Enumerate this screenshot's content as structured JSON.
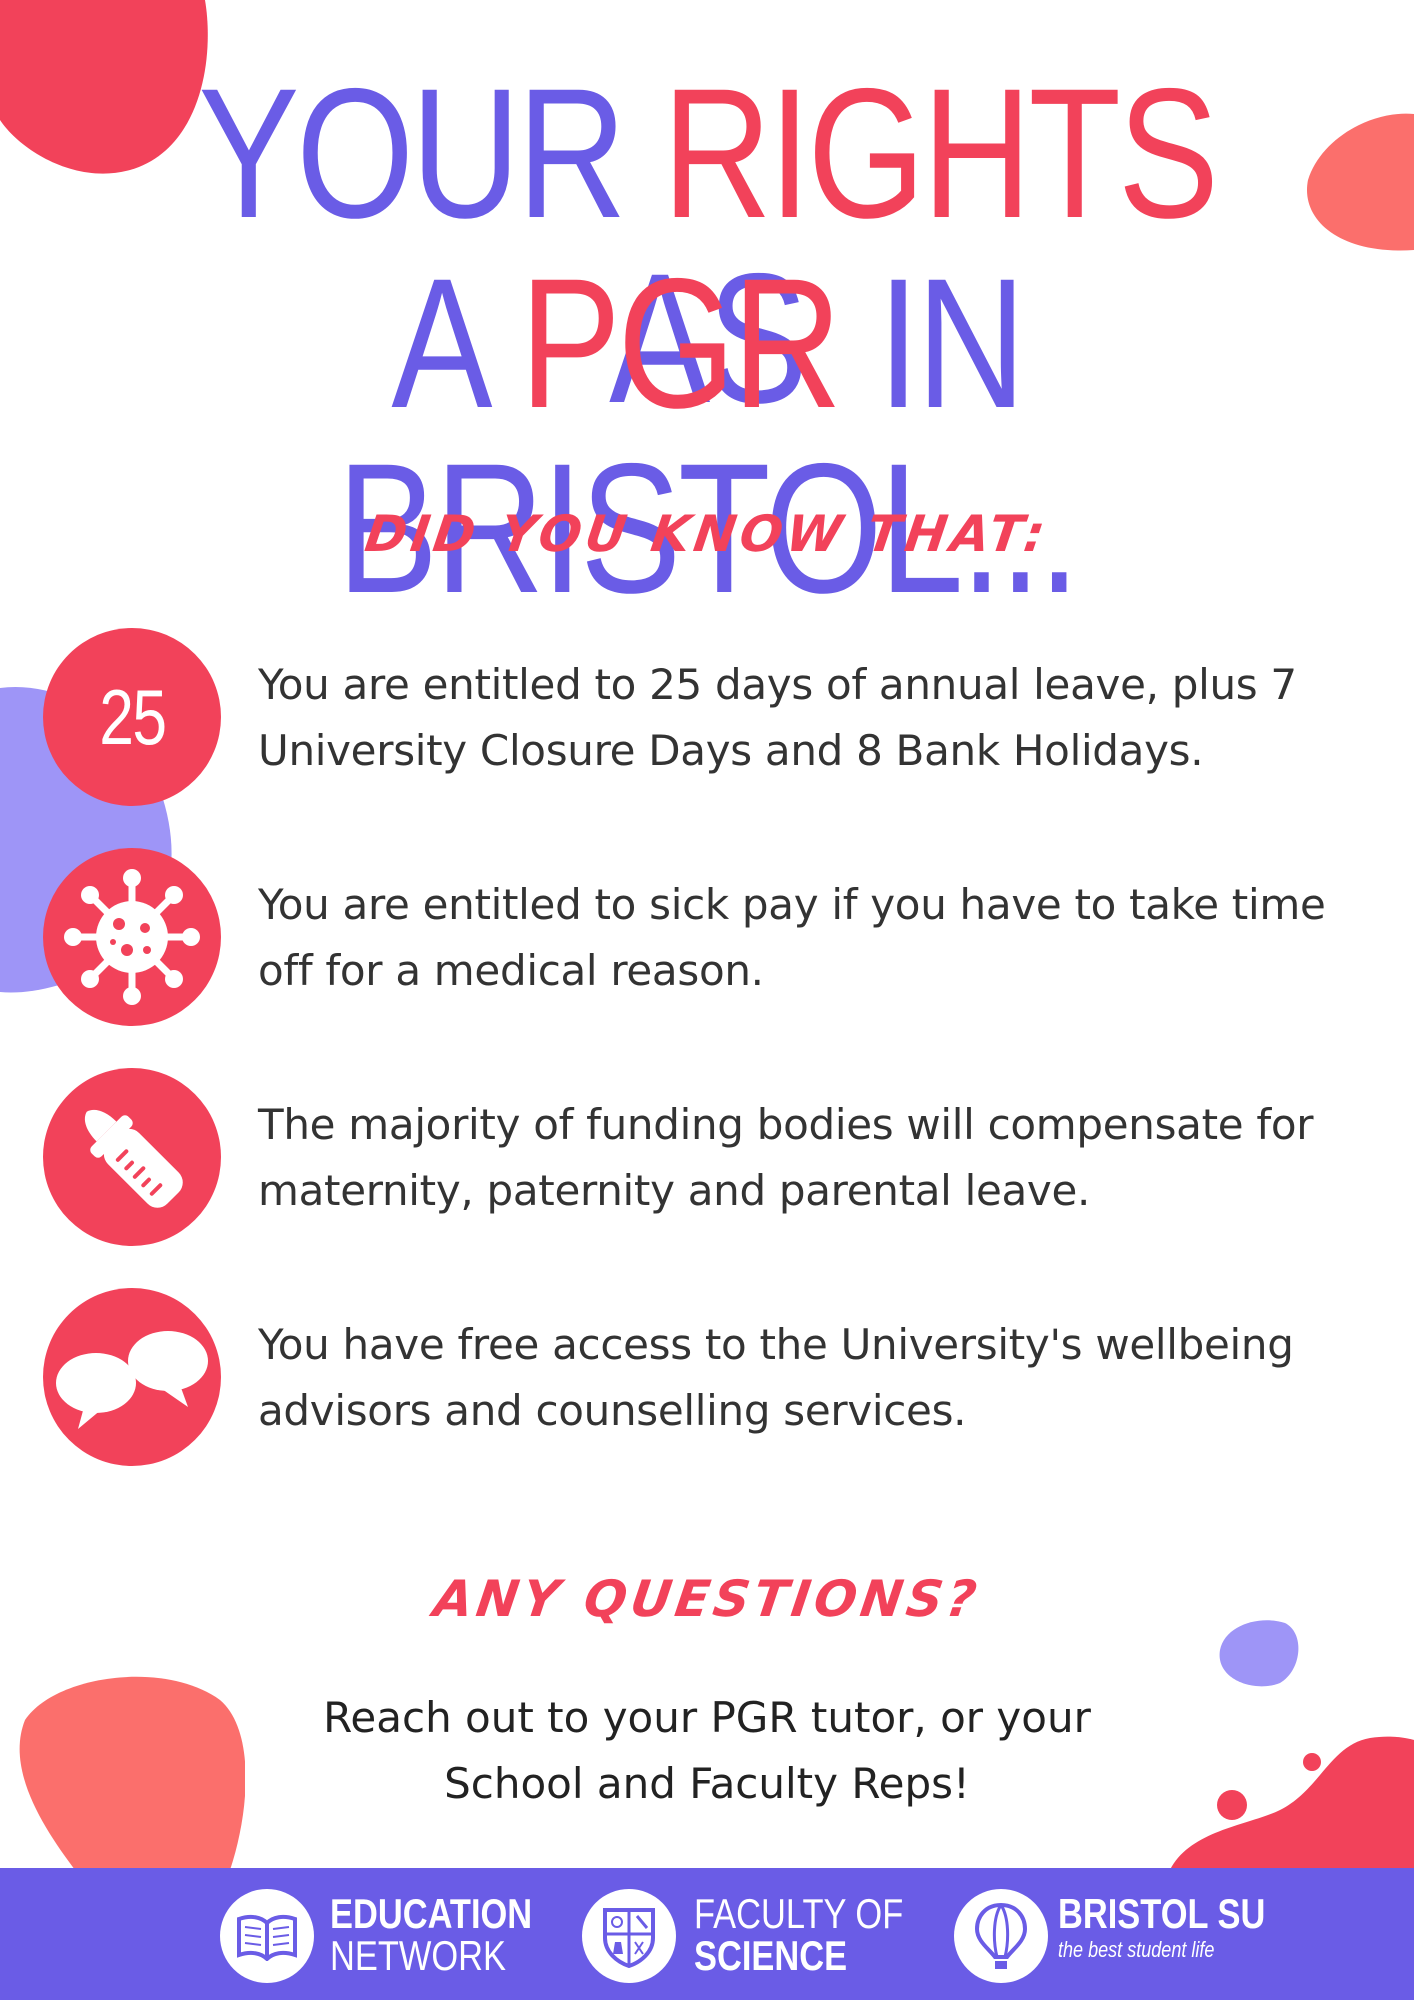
{
  "title": {
    "line1_part1": "YOUR ",
    "line1_accent": "RIGHTS",
    "line1_part2": " AS",
    "line2_part1": "A ",
    "line2_accent": "PGR",
    "line2_part2": " IN BRISTOL..."
  },
  "intro_heading": "DID YOU KNOW THAT:",
  "facts": [
    {
      "icon": "number-badge",
      "badge": "25",
      "text": "You are entitled to 25 days of annual leave, plus 7 University Closure Days and 8 Bank Holidays."
    },
    {
      "icon": "virus-icon",
      "text": "You are entitled to sick pay if you have to take time off for a medical reason."
    },
    {
      "icon": "baby-bottle-icon",
      "text": "The majority of funding bodies will compensate for maternity, paternity and parental leave."
    },
    {
      "icon": "speech-bubbles-icon",
      "text": "You have free access to the University's wellbeing advisors and counselling services."
    }
  ],
  "questions_heading": "ANY QUESTIONS?",
  "contact_line1": "Reach out to your PGR tutor, or your",
  "contact_line2": "School and Faculty Reps!",
  "footer": {
    "logos": [
      {
        "icon": "open-book-icon",
        "line1": "EDUCATION",
        "line2": "NETWORK"
      },
      {
        "icon": "science-crest-icon",
        "line1": "FACULTY OF",
        "line2": "SCIENCE"
      },
      {
        "icon": "hot-air-balloon-icon",
        "line1": "BRISTOL SU",
        "tagline": "the best student life"
      }
    ]
  },
  "colors": {
    "purple": "#6a5ce6",
    "red": "#f2425a",
    "coral": "#fb6f6c",
    "lavender": "#9e95f7"
  }
}
